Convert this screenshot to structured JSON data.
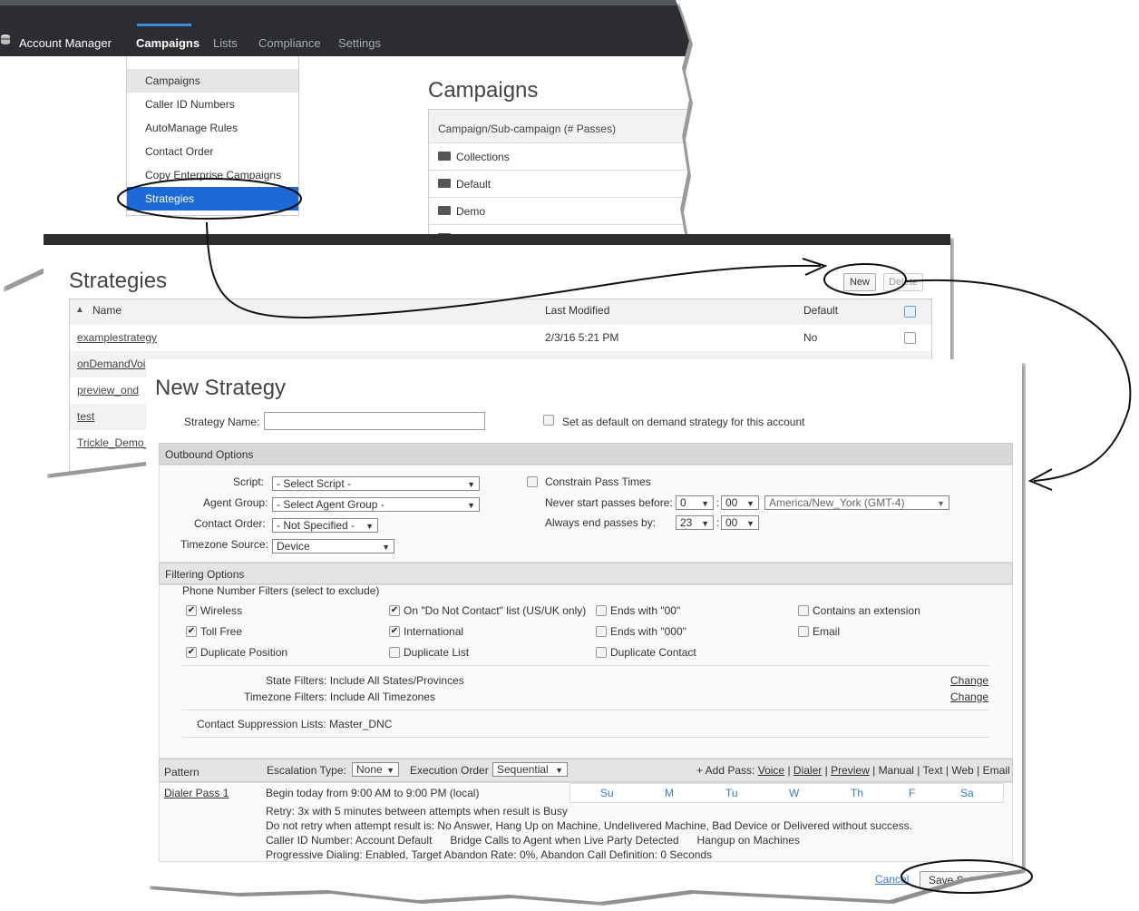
{
  "nav": {
    "app_name": "Account Manager",
    "tabs": [
      "Campaigns",
      "Lists",
      "Compliance",
      "Settings"
    ]
  },
  "dropdown": {
    "items": [
      "Campaigns",
      "Caller ID Numbers",
      "AutoManage Rules",
      "Contact Order",
      "Copy Enterprise Campaigns",
      "Strategies"
    ]
  },
  "campaigns": {
    "title": "Campaigns",
    "header": "Campaign/Sub-campaign (# Passes)",
    "rows": [
      "Collections",
      "Default",
      "Demo"
    ]
  },
  "strategies": {
    "title": "Strategies",
    "new_label": "New",
    "delete_label": "Delete",
    "columns": {
      "name": "Name",
      "last_modified": "Last Modified",
      "default": "Default"
    },
    "sort_icon": "▲",
    "rows": [
      {
        "name": "examplestrategy",
        "modified": "2/3/16 5:21 PM",
        "default": "No"
      },
      {
        "name": "onDemandVoi",
        "modified": "",
        "default": ""
      },
      {
        "name": "preview_ond",
        "modified": "",
        "default": ""
      },
      {
        "name": "test",
        "modified": "",
        "default": ""
      },
      {
        "name": "Trickle_Demo_",
        "modified": "",
        "default": ""
      }
    ]
  },
  "new_strategy": {
    "title": "New Strategy",
    "name_label": "Strategy Name:",
    "name_value": "",
    "set_default_label": "Set as default on demand strategy for this account",
    "outbound": {
      "header": "Outbound Options",
      "script_label": "Script:",
      "script_value": "- Select Script -",
      "agent_group_label": "Agent Group:",
      "agent_group_value": "- Select Agent Group -",
      "contact_order_label": "Contact Order:",
      "contact_order_value": "- Not Specified -",
      "tz_source_label": "Timezone Source:",
      "tz_source_value": "Device",
      "constrain_label": "Constrain Pass Times",
      "never_start_label": "Never start passes before:",
      "never_start_hour": "0",
      "never_start_min": "00",
      "timezone_value": "America/New_York (GMT-4)",
      "always_end_label": "Always end passes by:",
      "always_end_hour": "23",
      "always_end_min": "00",
      "colon": ":"
    },
    "filtering": {
      "header": "Filtering Options",
      "phone_filters_label": "Phone Number Filters (select to exclude)",
      "filters": [
        {
          "label": "Wireless",
          "checked": true
        },
        {
          "label": "On \"Do Not Contact\" list (US/UK only)",
          "checked": true
        },
        {
          "label": "Ends with \"00\"",
          "checked": false
        },
        {
          "label": "Contains an extension",
          "checked": false
        },
        {
          "label": "Toll Free",
          "checked": true
        },
        {
          "label": "International",
          "checked": true
        },
        {
          "label": "Ends with \"000\"",
          "checked": false
        },
        {
          "label": "Email",
          "checked": false
        },
        {
          "label": "Duplicate Position",
          "checked": true
        },
        {
          "label": "Duplicate List",
          "checked": false
        },
        {
          "label": "Duplicate Contact",
          "checked": false
        }
      ],
      "state_filters": "State Filters: Include All States/Provinces",
      "timezone_filters": "Timezone Filters: Include All Timezones",
      "change_label": "Change",
      "suppression": "Contact Suppression Lists: Master_DNC"
    },
    "pattern": {
      "header": "Pattern",
      "escalation_label": "Escalation Type:",
      "escalation_value": "None",
      "execution_label": "Execution Order",
      "execution_value": "Sequential",
      "add_pass_label": "+ Add Pass:",
      "add_pass_links": [
        "Voice",
        "Dialer",
        "Preview"
      ],
      "add_pass_text": [
        "Manual",
        "Text",
        "Web",
        "Email"
      ],
      "separator": "|",
      "pass_name": "Dialer Pass 1",
      "begin_text": "Begin today from  9:00 AM to 9:00 PM (local)",
      "days": [
        "Su",
        "M",
        "Tu",
        "W",
        "Th",
        "F",
        "Sa"
      ],
      "details": [
        "Retry: 3x with 5 minutes between attempts when result is Busy",
        "Do not retry when attempt result is: No Answer, Hang Up on Machine, Undelivered Machine, Bad Device or Delivered without success.",
        "Caller ID Number: Account Default      Bridge Calls to Agent when Live Party Detected      Hangup on Machines",
        "Progressive Dialing: Enabled, Target Abandon Rate: 0%, Abandon Call Definition: 0 Seconds"
      ]
    },
    "cancel_label": "Cancel",
    "save_label": "Save Settings"
  },
  "colors": {
    "nav_bg": "#2b2d30",
    "accent": "#3b8fe0",
    "highlight": "#1b6ad6",
    "section": "#d8d8d8"
  }
}
